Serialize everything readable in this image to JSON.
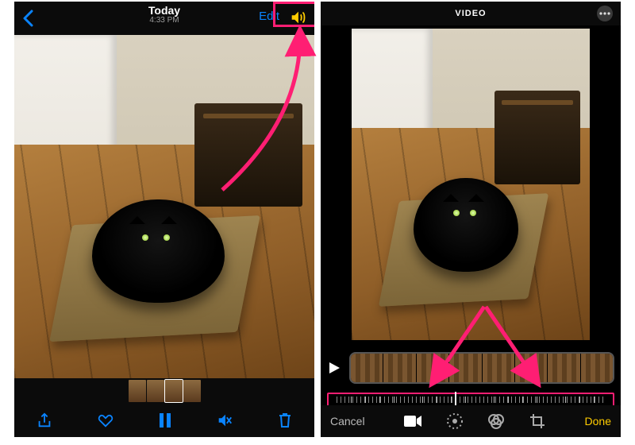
{
  "viewer": {
    "title": "Today",
    "time": "4:33 PM",
    "edit_label": "Edit",
    "bottom_icons": [
      "share",
      "favorite",
      "pause",
      "mute",
      "delete"
    ]
  },
  "editor": {
    "mode_label": "VIDEO",
    "cancel_label": "Cancel",
    "done_label": "Done",
    "tools": [
      "video",
      "adjust",
      "filters",
      "crop"
    ],
    "active_tool": "video"
  },
  "annotation": {
    "highlight": "edit-button",
    "arrows": [
      "to-edit-button",
      "to-scrubber"
    ]
  }
}
